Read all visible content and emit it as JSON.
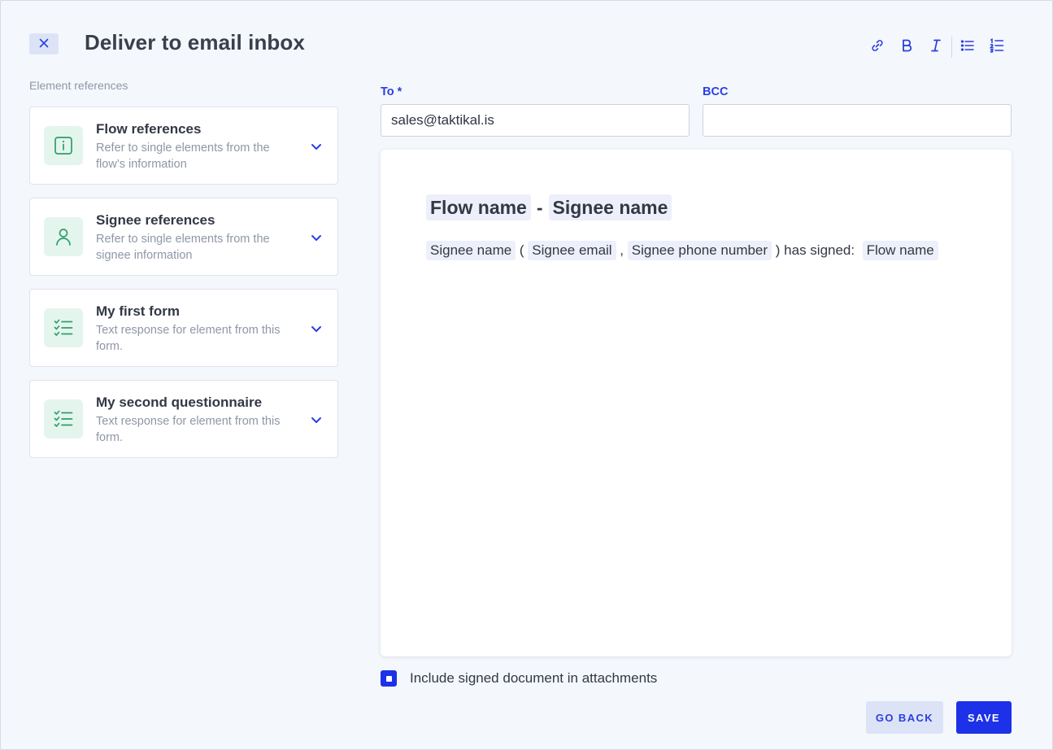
{
  "header": {
    "title": "Deliver to email inbox",
    "close_icon": "close-icon"
  },
  "toolbar": {
    "buttons": [
      {
        "name": "link-icon"
      },
      {
        "name": "bold-icon"
      },
      {
        "name": "italic-icon"
      },
      {
        "name": "bullet-list-icon"
      },
      {
        "name": "numbered-list-icon"
      }
    ]
  },
  "sidebar": {
    "label": "Element references",
    "items": [
      {
        "title": "Flow references",
        "description": "Refer to single elements from the flow’s information",
        "icon": "info-icon"
      },
      {
        "title": "Signee references",
        "description": "Refer to single elements from the signee information",
        "icon": "user-icon"
      },
      {
        "title": "My first form",
        "description": "Text response for element from this form.",
        "icon": "checklist-icon"
      },
      {
        "title": "My second questionnaire",
        "description": "Text response for element from this form.",
        "icon": "checklist-icon"
      }
    ]
  },
  "form": {
    "to_label": "To *",
    "to_value": "sales@taktikal.is",
    "bcc_label": "BCC",
    "bcc_value": ""
  },
  "editor": {
    "heading": {
      "first_chip": "Flow name",
      "separator": "-",
      "second_chip": "Signee name"
    },
    "body": {
      "chip_name": "Signee name",
      "open_paren": " ( ",
      "chip_email": "Signee email",
      "comma": " , ",
      "chip_phone": "Signee phone number",
      "text_signed": " ) has signed:  ",
      "chip_flow": "Flow name"
    }
  },
  "attachments": {
    "checked": true,
    "label": "Include signed document in attachments"
  },
  "actions": {
    "back_label": "GO BACK",
    "save_label": "SAVE"
  },
  "colors": {
    "accent": "#1c31e8",
    "accent_soft": "#dde3f7",
    "icon_green": "#2e9e6b",
    "icon_bg": "#e4f5ee",
    "background": "#f4f7fc"
  }
}
